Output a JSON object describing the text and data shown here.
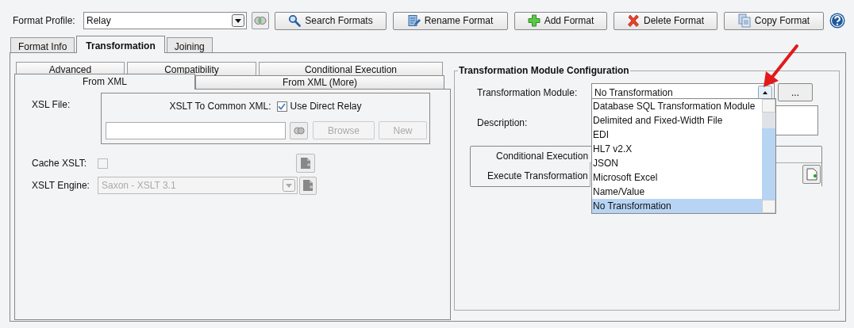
{
  "format_profile": {
    "label": "Format Profile:",
    "value": "Relay"
  },
  "toolbar_buttons": [
    {
      "label": "Search Formats",
      "kind": "search"
    },
    {
      "label": "Rename Format",
      "kind": "rename"
    },
    {
      "label": "Add Format",
      "kind": "add"
    },
    {
      "label": "Delete Format",
      "kind": "delete"
    },
    {
      "label": "Copy Format",
      "kind": "copy"
    }
  ],
  "tabs": [
    {
      "label": "Format Info",
      "selected": false
    },
    {
      "label": "Transformation",
      "selected": true
    },
    {
      "label": "Joining",
      "selected": false
    }
  ],
  "sub_tabs_back": [
    {
      "label": "Advanced",
      "selected": false
    },
    {
      "label": "Compatibility",
      "selected": false
    },
    {
      "label": "Conditional Execution",
      "selected": false
    }
  ],
  "sub_tabs_front": [
    {
      "label": "From XML",
      "selected": true
    },
    {
      "label": "From XML (More)",
      "selected": false
    }
  ],
  "from_xml": {
    "xsl_file_label": "XSL File:",
    "xslt_to_common_label": "XSLT To Common XML:",
    "use_direct_relay": {
      "label": "Use Direct Relay",
      "checked": true
    },
    "browse": {
      "label": "Browse",
      "disabled": true
    },
    "new": {
      "label": "New",
      "disabled": true
    },
    "cache_xslt": {
      "label": "Cache XSLT:",
      "checked": false,
      "disabled": true
    },
    "xslt_engine": {
      "label": "XSLT Engine:",
      "value": "Saxon - XSLT 3.1",
      "disabled": true
    }
  },
  "module_config": {
    "title": "Transformation Module Configuration",
    "module_label": "Transformation Module:",
    "module_value": "No Transformation",
    "more_button": "...",
    "description_label": "Description:",
    "conditional_title": "Conditional Execution",
    "execute_label": "Execute Transformation",
    "dropdown_options": [
      {
        "label": "Database SQL Transformation Module",
        "selected": false
      },
      {
        "label": "Delimited and Fixed-Width File",
        "selected": false
      },
      {
        "label": "EDI",
        "selected": false
      },
      {
        "label": "HL7 v2.X",
        "selected": false
      },
      {
        "label": "JSON",
        "selected": false
      },
      {
        "label": "Microsoft Excel",
        "selected": false
      },
      {
        "label": "Name/Value",
        "selected": false
      },
      {
        "label": "No Transformation",
        "selected": true
      }
    ]
  }
}
